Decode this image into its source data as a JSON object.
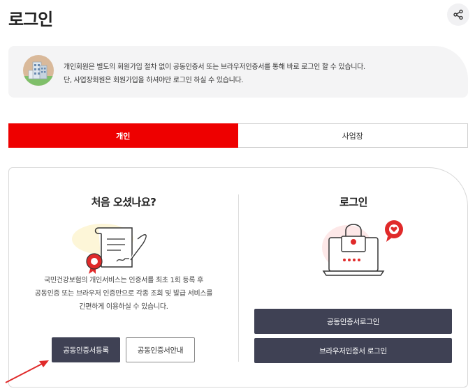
{
  "header": {
    "title": "로그인",
    "share_icon": "share-icon"
  },
  "notice": {
    "line1": "개인회원은 별도의 회원가입 절차 없이 공동인증서 또는 브라우저인증서를 통해 바로 로그인 할 수 있습니다.",
    "line2": "단, 사업장회원은 회원가입을 하셔야만 로그인 하실 수 있습니다."
  },
  "tabs": [
    {
      "label": "개인",
      "active": true
    },
    {
      "label": "사업장",
      "active": false
    }
  ],
  "left": {
    "title": "처음 오셨나요?",
    "desc": [
      "국민건강보험의 개인서비스는 인증서를 최초 1회 등록 후",
      "공동인증 또는 브라우저 인증만으로 각종 조회 및 발급 서비스를",
      "간편하게 이용하실 수 있습니다."
    ],
    "register_label": "공동인증서등록",
    "guide_label": "공동인증서안내"
  },
  "right": {
    "title": "로그인",
    "joint_login_label": "공동인증서로그인",
    "browser_login_label": "브라우저인증서 로그인"
  },
  "colors": {
    "accent": "#ee0000",
    "button_dark": "#3f4154",
    "notice_bg": "#f4f4f5"
  }
}
